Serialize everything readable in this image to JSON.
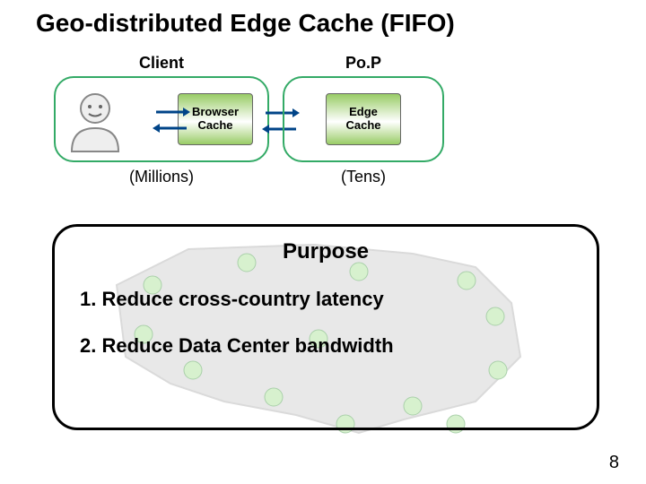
{
  "title": "Geo-distributed Edge Cache (FIFO)",
  "client": {
    "group_label": "Client",
    "cache_l1": "Browser",
    "cache_l2": "Cache",
    "footnote": "(Millions)"
  },
  "pop": {
    "group_label": "Po.P",
    "cache_l1": "Edge",
    "cache_l2": "Cache",
    "footnote": "(Tens)"
  },
  "purpose": {
    "heading": "Purpose",
    "item1": "1.  Reduce cross-country latency",
    "item2": "2.  Reduce Data Center bandwidth"
  },
  "page_number": "8",
  "icons": {
    "user": "user-icon",
    "bidir_arrows": "bidirectional-arrows",
    "us_map": "us-map-backdrop"
  }
}
